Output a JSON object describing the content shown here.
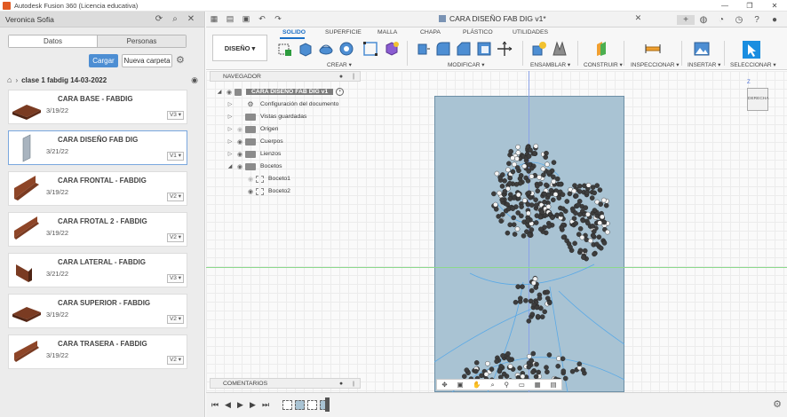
{
  "window": {
    "title": "Autodesk Fusion 360 (Licencia educativa)",
    "controls": [
      "—",
      "❐",
      "✕"
    ]
  },
  "user": {
    "name": "Veronica Sofia",
    "icons": [
      "refresh-icon",
      "search-icon",
      "close-icon"
    ]
  },
  "datapanel": {
    "tabs": [
      "Datos",
      "Personas"
    ],
    "upload_label": "Cargar",
    "new_folder_label": "Nueva carpeta",
    "breadcrumb_folder": "clase 1 fabdig 14-03-2022",
    "files": [
      {
        "name": "CARA BASE - FABDIG",
        "date": "3/19/22",
        "version": "V3"
      },
      {
        "name": "CARA DISEÑO FAB DIG",
        "date": "3/21/22",
        "version": "V1"
      },
      {
        "name": "CARA FRONTAL - FABDIG",
        "date": "3/19/22",
        "version": "V2"
      },
      {
        "name": "CARA FROTAL 2 - FABDIG",
        "date": "3/19/22",
        "version": "V2"
      },
      {
        "name": "CARA LATERAL - FABDIG",
        "date": "3/21/22",
        "version": "V3"
      },
      {
        "name": "CARA SUPERIOR - FABDIG",
        "date": "3/19/22",
        "version": "V2"
      },
      {
        "name": "CARA TRASERA - FABDIG",
        "date": "3/19/22",
        "version": "V2"
      }
    ]
  },
  "document_tab": {
    "title": "CARA DISEÑO FAB DIG v1*"
  },
  "ribbon": {
    "workspace": "DISEÑO",
    "tabs": [
      "SOLIDO",
      "SUPERFICIE",
      "MALLA",
      "CHAPA",
      "PLÁSTICO",
      "UTILIDADES"
    ],
    "active_tab": "SOLIDO",
    "groups": [
      "CREAR",
      "MODIFICAR",
      "ENSAMBLAR",
      "CONSTRUIR",
      "INSPECCIONAR",
      "INSERTAR",
      "SELECCIONAR"
    ]
  },
  "navigator": {
    "label": "NAVEGADOR",
    "root": "CARA DISEÑO FAB DIG v1",
    "items": [
      "Configuración del documento",
      "Vistas guardadas",
      "Origen",
      "Cuerpos",
      "Lienzos",
      "Bocetos"
    ],
    "sketches": [
      "Boceto1",
      "Boceto2"
    ]
  },
  "viewcube": {
    "face_label": "DERECHA",
    "axis_label": "Z"
  },
  "comments": {
    "label": "COMENTARIOS"
  },
  "colors": {
    "accent": "#1a6fc6",
    "button_primary": "#4d8ed3",
    "sketch_area": "#a9c3d3"
  }
}
